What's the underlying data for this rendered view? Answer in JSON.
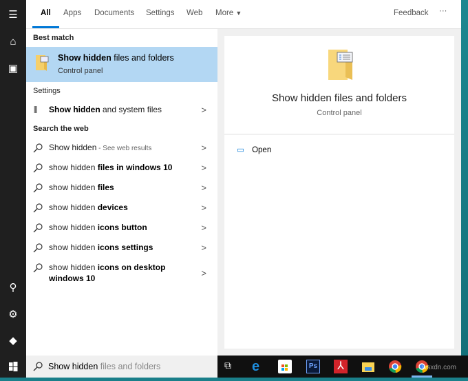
{
  "tabs": {
    "items": [
      "All",
      "Apps",
      "Documents",
      "Settings",
      "Web",
      "More"
    ],
    "feedback": "Feedback",
    "ellipsis": "···"
  },
  "best_match": {
    "heading": "Best match",
    "title_bold": "Show hidden",
    "title_rest": " files and folders",
    "subtitle": "Control panel"
  },
  "settings": {
    "heading": "Settings",
    "item_bold": "Show hidden",
    "item_rest": " and system files"
  },
  "web": {
    "heading": "Search the web",
    "items": [
      {
        "plain": "Show hidden",
        "bold": "",
        "suffix": " - See web results"
      },
      {
        "plain": "show hidden ",
        "bold": "files in windows 10",
        "suffix": ""
      },
      {
        "plain": "show hidden ",
        "bold": "files",
        "suffix": ""
      },
      {
        "plain": "show hidden ",
        "bold": "devices",
        "suffix": ""
      },
      {
        "plain": "show hidden ",
        "bold": "icons button",
        "suffix": ""
      },
      {
        "plain": "show hidden ",
        "bold": "icons settings",
        "suffix": ""
      },
      {
        "plain": "show hidden ",
        "bold": "icons on desktop windows 10",
        "suffix": ""
      }
    ]
  },
  "preview": {
    "title": "Show hidden files and folders",
    "subtitle": "Control panel",
    "open": "Open"
  },
  "search": {
    "typed": "Show hidden",
    "suggest": " files and folders"
  },
  "watermark": "wsxdn.com"
}
